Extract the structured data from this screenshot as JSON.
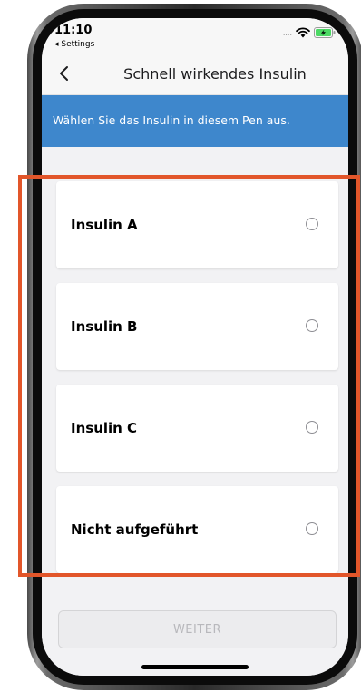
{
  "status_bar": {
    "time": "11:10",
    "back_label": "◂ Settings",
    "signal_dots": "....",
    "icons": [
      "wifi-icon",
      "battery-charging-icon"
    ]
  },
  "nav": {
    "back_icon": "chevron-left-icon",
    "title": "Schnell wirkendes Insulin"
  },
  "banner": {
    "text": "Wählen Sie das Insulin in diesem Pen aus."
  },
  "options": [
    {
      "label": "Insulin A",
      "selected": false
    },
    {
      "label": "Insulin B",
      "selected": false
    },
    {
      "label": "Insulin C",
      "selected": false
    },
    {
      "label": "Nicht aufgeführt",
      "selected": false
    }
  ],
  "footer": {
    "weiter_label": "WEITER",
    "weiter_enabled": false
  },
  "colors": {
    "banner": "#3e87cc",
    "highlight": "#e2562a",
    "screen_bg": "#f2f2f4"
  }
}
